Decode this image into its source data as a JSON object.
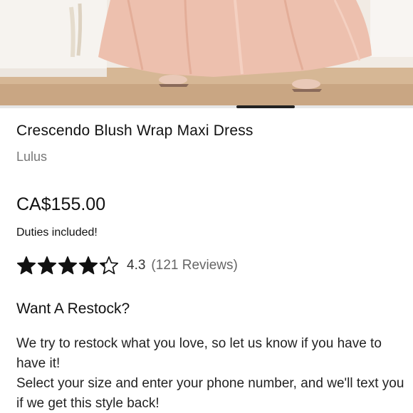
{
  "product": {
    "title": "Crescendo Blush Wrap Maxi Dress",
    "brand": "Lulus",
    "price": "CA$155.00",
    "duties_note": "Duties included!"
  },
  "rating": {
    "score": 4.3,
    "score_label": "4.3",
    "max_stars": 5,
    "reviews_label": "(121 Reviews)",
    "star_color": "#111111"
  },
  "restock": {
    "heading": "Want A Restock?",
    "line1": "We try to restock what you love, so let us know if you have to have it!",
    "line2": "Select your size and enter your phone number, and we'll text you if we get this style back!"
  },
  "gallery": {
    "image_subject": "blush-dress-photo",
    "accent_color": "#e8b6a6"
  }
}
